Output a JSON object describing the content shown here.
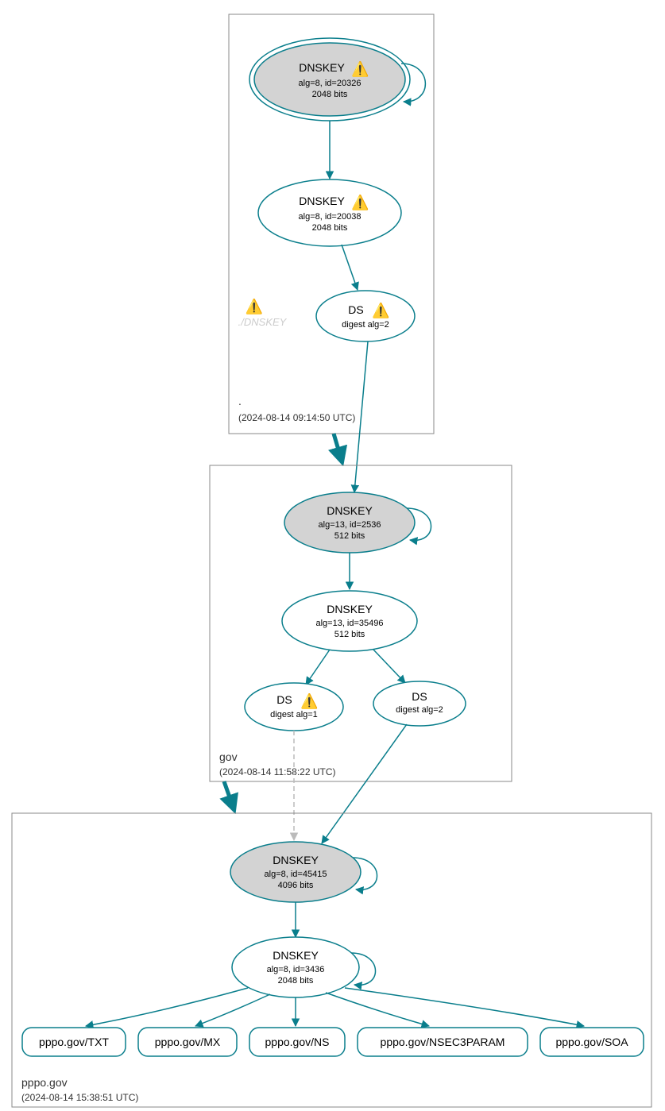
{
  "warning_glyph": "⚠️",
  "zones": {
    "root": {
      "label": ".",
      "timestamp": "(2024-08-14 09:14:50 UTC)",
      "ksk": {
        "title": "DNSKEY",
        "line1": "alg=8, id=20326",
        "line2": "2048 bits",
        "warn": true
      },
      "zsk": {
        "title": "DNSKEY",
        "line1": "alg=8, id=20038",
        "line2": "2048 bits",
        "warn": true
      },
      "ds": {
        "title": "DS",
        "line1": "digest alg=2",
        "warn": true
      },
      "ghost": "./DNSKEY"
    },
    "gov": {
      "label": "gov",
      "timestamp": "(2024-08-14 11:58:22 UTC)",
      "ksk": {
        "title": "DNSKEY",
        "line1": "alg=13, id=2536",
        "line2": "512 bits"
      },
      "zsk": {
        "title": "DNSKEY",
        "line1": "alg=13, id=35496",
        "line2": "512 bits"
      },
      "ds1": {
        "title": "DS",
        "line1": "digest alg=1",
        "warn": true
      },
      "ds2": {
        "title": "DS",
        "line1": "digest alg=2"
      }
    },
    "pppo": {
      "label": "pppo.gov",
      "timestamp": "(2024-08-14 15:38:51 UTC)",
      "ksk": {
        "title": "DNSKEY",
        "line1": "alg=8, id=45415",
        "line2": "4096 bits"
      },
      "zsk": {
        "title": "DNSKEY",
        "line1": "alg=8, id=3436",
        "line2": "2048 bits"
      },
      "leaves": {
        "txt": "pppo.gov/TXT",
        "mx": "pppo.gov/MX",
        "ns": "pppo.gov/NS",
        "nsec3": "pppo.gov/NSEC3PARAM",
        "soa": "pppo.gov/SOA"
      }
    }
  }
}
